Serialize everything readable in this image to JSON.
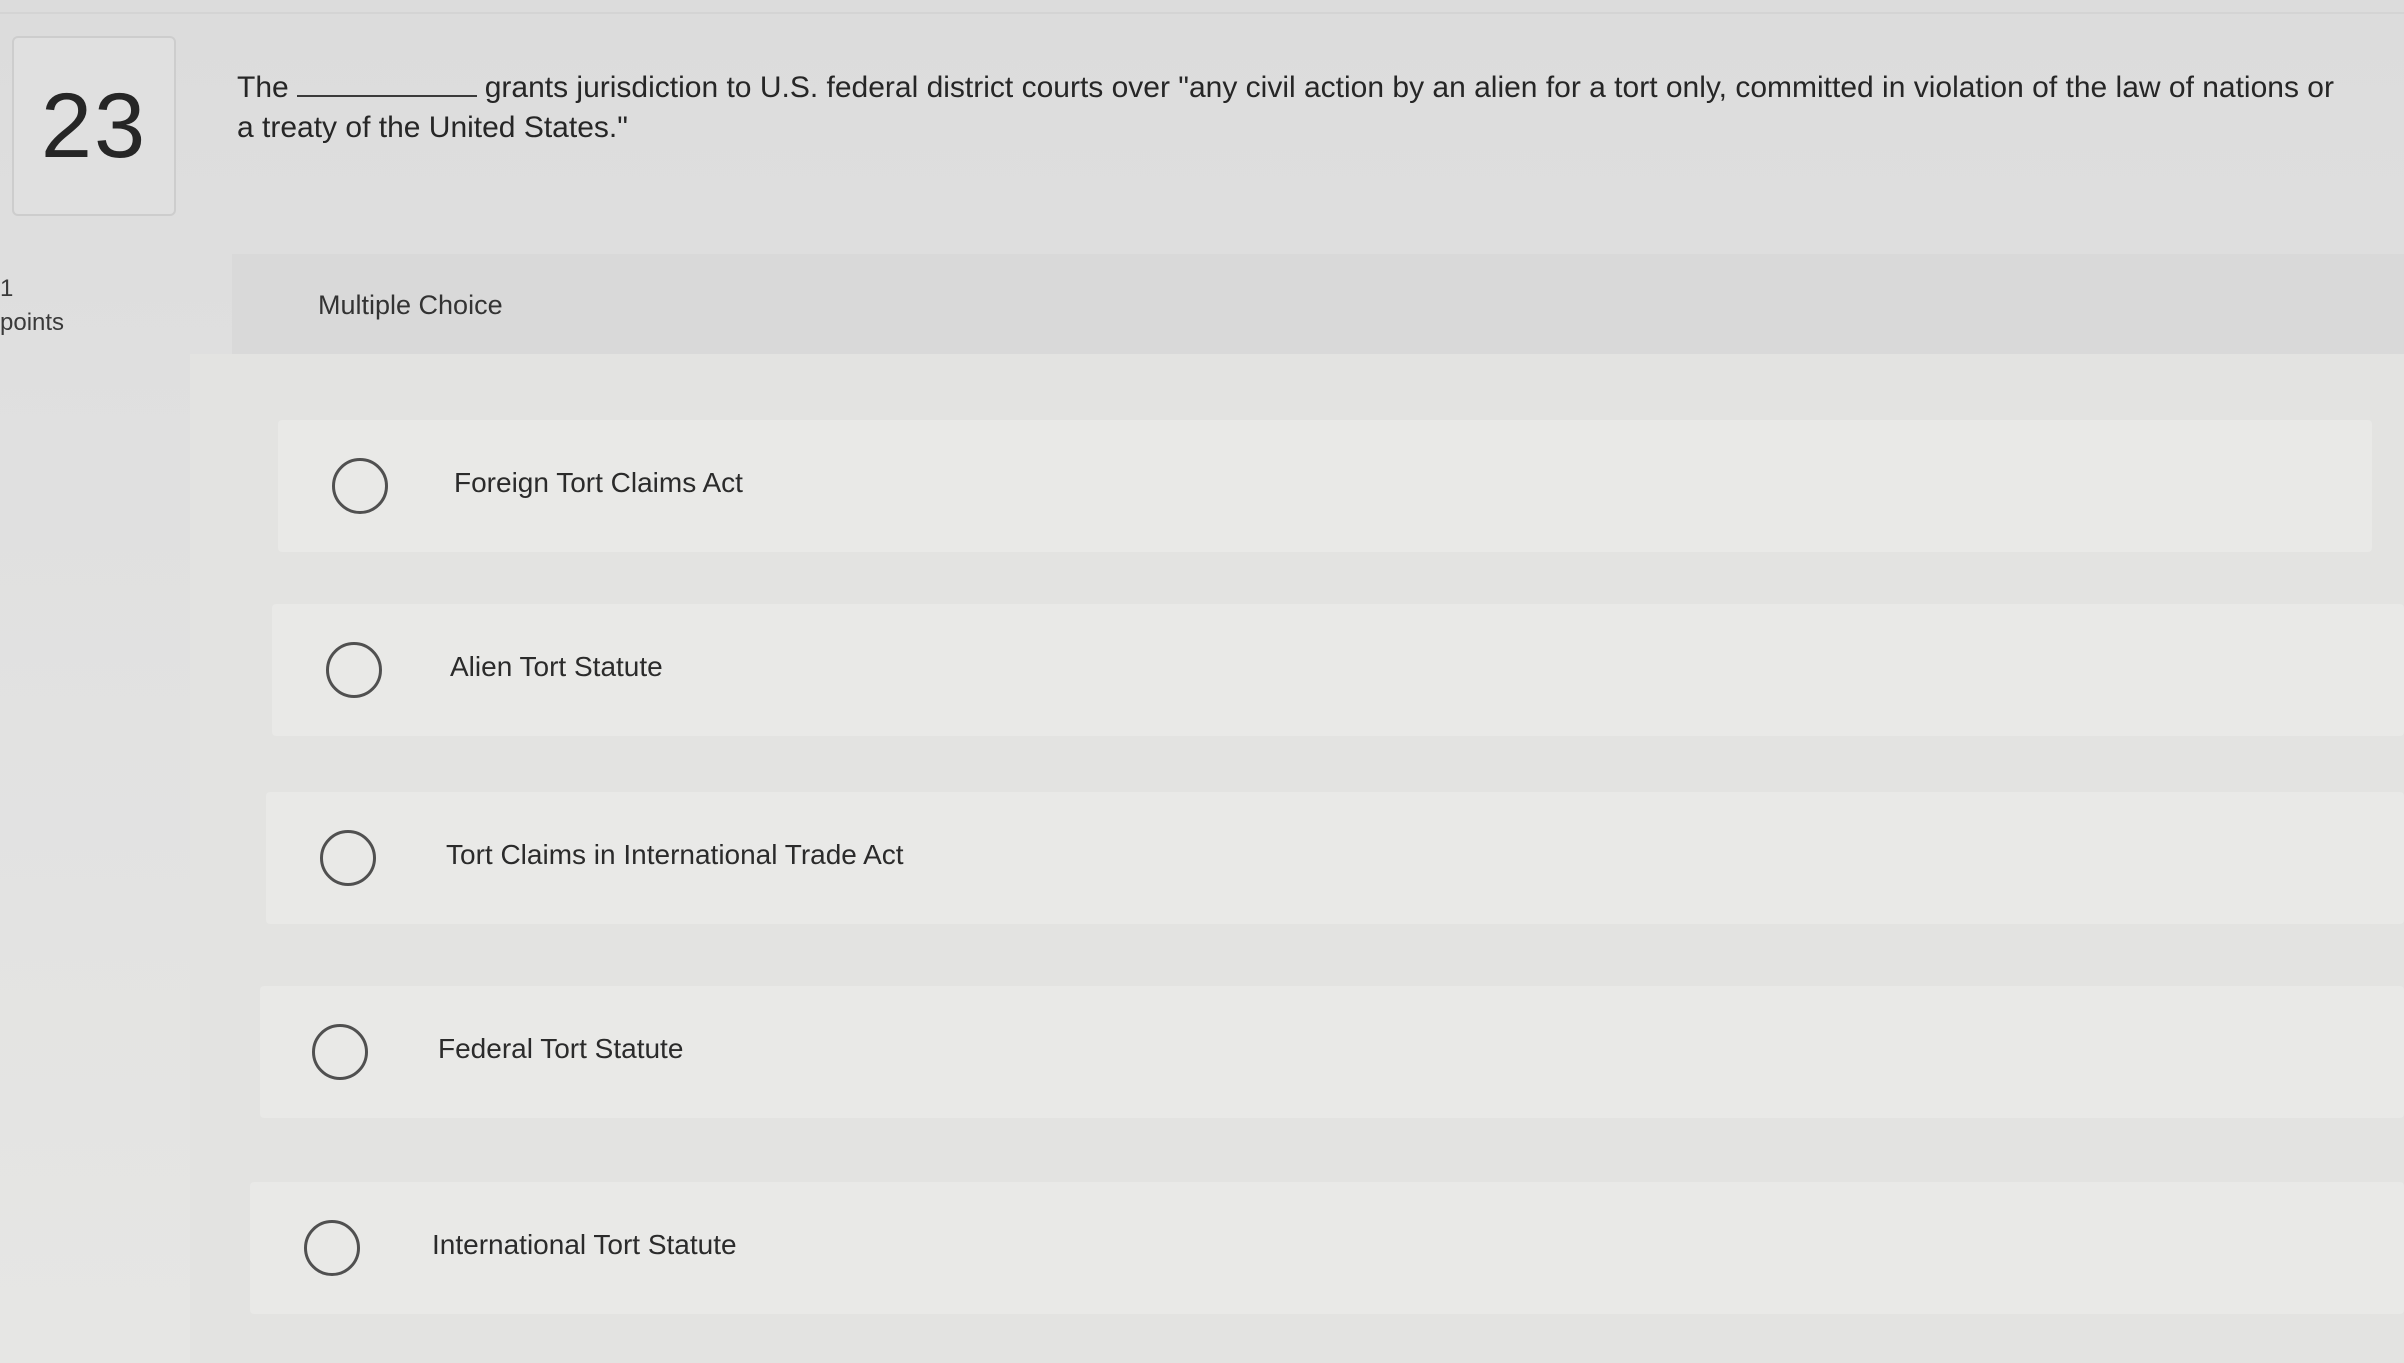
{
  "question": {
    "number": "23",
    "text_before": "The",
    "text_after": "grants jurisdiction to U.S. federal district courts over \"any civil action by an alien for a tort only, committed in violation of the law of nations or a treaty of the United States.\""
  },
  "points": {
    "value": "1",
    "label": "points"
  },
  "question_type": "Multiple Choice",
  "choices": [
    {
      "label": "Foreign Tort Claims Act",
      "selected": false
    },
    {
      "label": "Alien Tort Statute",
      "selected": false
    },
    {
      "label": "Tort Claims in International Trade Act",
      "selected": false
    },
    {
      "label": "Federal Tort Statute",
      "selected": false
    },
    {
      "label": "International Tort Statute",
      "selected": false
    }
  ]
}
